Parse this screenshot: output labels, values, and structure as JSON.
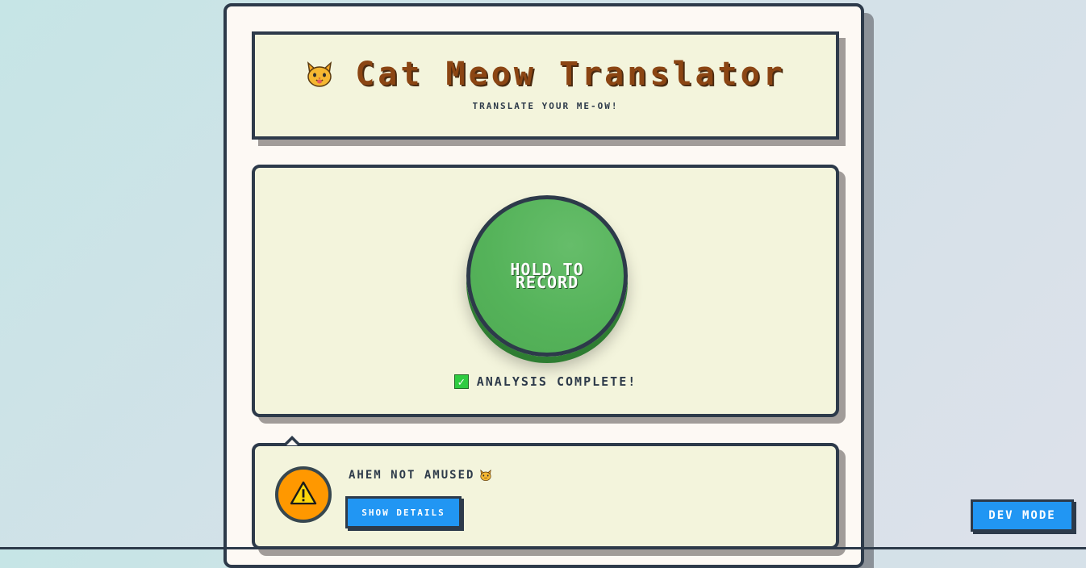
{
  "header": {
    "title": "Cat Meow Translator",
    "subtitle": "TRANSLATE YOUR ME-OW!",
    "logo_icon": "cat-face-icon"
  },
  "recorder": {
    "button_label": "HOLD TO RECORD",
    "status_icon": "check-icon",
    "status_text": "ANALYSIS COMPLETE!"
  },
  "result": {
    "icon": "warning-icon",
    "message": "AHEM NOT AMUSED",
    "message_icon": "cat-face-icon",
    "details_label": "SHOW DETAILS"
  },
  "dev": {
    "label": "DEV MODE"
  },
  "colors": {
    "title": "#8b4513",
    "record_button": "#55b35a",
    "warning_badge": "#ff9800",
    "action_button": "#2196f3",
    "border": "#2d3a4a",
    "card_bg": "#f3f4dc"
  }
}
